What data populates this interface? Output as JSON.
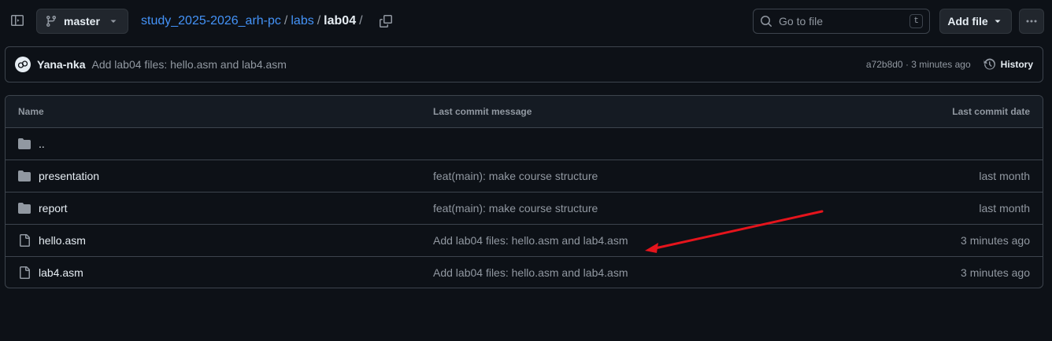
{
  "toolbar": {
    "branch": "master",
    "breadcrumb": {
      "repo": "study_2025-2026_arh-pc",
      "folder": "labs",
      "current": "lab04",
      "sep": "/"
    },
    "goto_placeholder": "Go to file",
    "goto_shortcut": "t",
    "add_file_label": "Add file"
  },
  "commit": {
    "author": "Yana-nka",
    "message": "Add lab04 files: hello.asm and lab4.asm",
    "meta": "a72b8d0 · 3 minutes ago",
    "history_label": "History"
  },
  "table": {
    "headers": {
      "name": "Name",
      "message": "Last commit message",
      "date": "Last commit date"
    },
    "rows": [
      {
        "name": "..",
        "type": "folder",
        "message": "",
        "date": ""
      },
      {
        "name": "presentation",
        "type": "folder",
        "message": "feat(main): make course structure",
        "date": "last month"
      },
      {
        "name": "report",
        "type": "folder",
        "message": "feat(main): make course structure",
        "date": "last month"
      },
      {
        "name": "hello.asm",
        "type": "file",
        "message": "Add lab04 files: hello.asm and lab4.asm",
        "date": "3 minutes ago"
      },
      {
        "name": "lab4.asm",
        "type": "file",
        "message": "Add lab04 files: hello.asm and lab4.asm",
        "date": "3 minutes ago"
      }
    ]
  },
  "colors": {
    "background": "#0d1117",
    "accent_link": "#4493f8",
    "annotation_arrow": "#e5141c"
  },
  "icons": {
    "sidebar_toggle": "sidebar-expand-icon",
    "branch": "git-branch-icon",
    "copy": "copy-icon",
    "search": "search-icon",
    "more": "kebab-horizontal-icon",
    "history": "history-clock-icon",
    "folder": "folder-icon",
    "file": "file-icon"
  }
}
